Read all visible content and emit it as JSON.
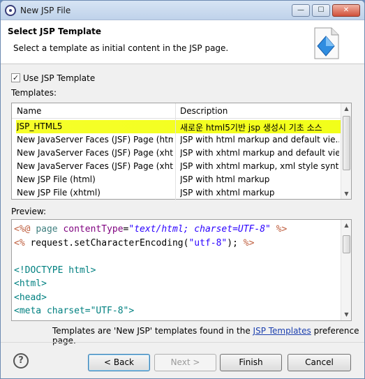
{
  "window": {
    "title": "New JSP File",
    "min_label": "—",
    "max_label": "☐",
    "close_label": "✕"
  },
  "header": {
    "title": "Select JSP Template",
    "description": "Select a template as initial content in the JSP page."
  },
  "use_template": {
    "label": "Use JSP Template",
    "checked": true,
    "check_glyph": "✓"
  },
  "templates": {
    "label": "Templates:",
    "columns": {
      "name": "Name",
      "description": "Description"
    },
    "rows": [
      {
        "name": "JSP_HTML5",
        "description": "새로운 html5기반 jsp 생성시 기초 소스",
        "selected": true
      },
      {
        "name": "New JavaServer Faces (JSF) Page (html)",
        "description": "JSP with html markup and default vie..."
      },
      {
        "name": "New JavaServer Faces (JSF) Page (xhtml)",
        "description": "JSP with xhtml markup and default vie..."
      },
      {
        "name": "New JavaServer Faces (JSF) Page (xhtml...",
        "description": "JSP with xhtml markup, xml style synt..."
      },
      {
        "name": "New JSP File (html)",
        "description": "JSP with html markup"
      },
      {
        "name": "New JSP File (xhtml)",
        "description": "JSP with xhtml markup"
      }
    ]
  },
  "preview": {
    "label": "Preview:",
    "lines": [
      [
        {
          "t": "<%@ ",
          "c": "#bf5f3f"
        },
        {
          "t": "page ",
          "c": "#3f7f7f"
        },
        {
          "t": "contentType",
          "c": "#7f007f"
        },
        {
          "t": "=",
          "c": "#000000"
        },
        {
          "t": "\"text/html; charset=UTF-8\"",
          "c": "#2a00ff",
          "i": true
        },
        {
          "t": " %>",
          "c": "#bf5f3f"
        }
      ],
      [
        {
          "t": "<% ",
          "c": "#bf5f3f"
        },
        {
          "t": "request.setCharacterEncoding(",
          "c": "#000000"
        },
        {
          "t": "\"utf-8\"",
          "c": "#2a00ff"
        },
        {
          "t": "); ",
          "c": "#000000"
        },
        {
          "t": "%>",
          "c": "#bf5f3f"
        }
      ],
      [],
      [
        {
          "t": "<!DOCTYPE html>",
          "c": "#008080"
        }
      ],
      [
        {
          "t": "<html>",
          "c": "#008080"
        }
      ],
      [
        {
          "t": "<head>",
          "c": "#008080"
        }
      ],
      [
        {
          "t": "<meta charset=\"UTF-8\">",
          "c": "#008080"
        }
      ]
    ]
  },
  "footer_note": {
    "prefix": "Templates are 'New JSP' templates found in the ",
    "link": "JSP Templates",
    "suffix": " preference page."
  },
  "buttons": {
    "help": "?",
    "back": "< Back",
    "next": "Next >",
    "finish": "Finish",
    "cancel": "Cancel"
  },
  "scroll_arrows": {
    "up": "▲",
    "down": "▼"
  },
  "colors": {
    "highlight": "#f2ff1a",
    "link": "#1b3fae"
  }
}
